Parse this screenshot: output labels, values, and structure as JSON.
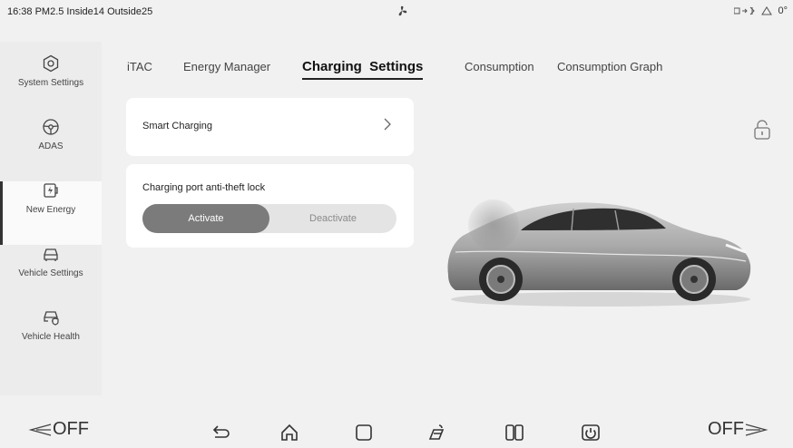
{
  "status": {
    "left_text": "16:38 PM2.5 Inside14 Outside25",
    "right_text": "0°"
  },
  "sidebar": {
    "items": [
      {
        "label": "System Settings",
        "icon": "settings-hexagon-icon"
      },
      {
        "label": "ADAS",
        "icon": "steering-wheel-icon"
      },
      {
        "label": "New Energy",
        "icon": "battery-bolt-icon",
        "active": true
      },
      {
        "label": "Vehicle Settings",
        "icon": "car-outline-icon"
      },
      {
        "label": "Vehicle Health",
        "icon": "car-shield-icon"
      }
    ]
  },
  "tabs": [
    {
      "label": "iTAC"
    },
    {
      "label": "Energy Manager"
    },
    {
      "label": "Charging  Settings",
      "active": true
    },
    {
      "label": "Consumption"
    },
    {
      "label": "Consumption Graph"
    }
  ],
  "smart_charging": {
    "label": "Smart Charging"
  },
  "lock_card": {
    "label": "Charging port anti-theft lock",
    "options": [
      "Activate",
      "Deactivate"
    ],
    "selected": "Activate"
  },
  "bottom": {
    "fan_left": "OFF",
    "fan_right": "OFF",
    "nav_icons": [
      "back-icon",
      "home-icon",
      "recent-apps-icon",
      "car-camera-icon",
      "split-screen-icon",
      "power-icon"
    ]
  },
  "colors": {
    "background": "#f1f1f1",
    "card": "#ffffff",
    "active_segment": "#7b7b7b"
  }
}
